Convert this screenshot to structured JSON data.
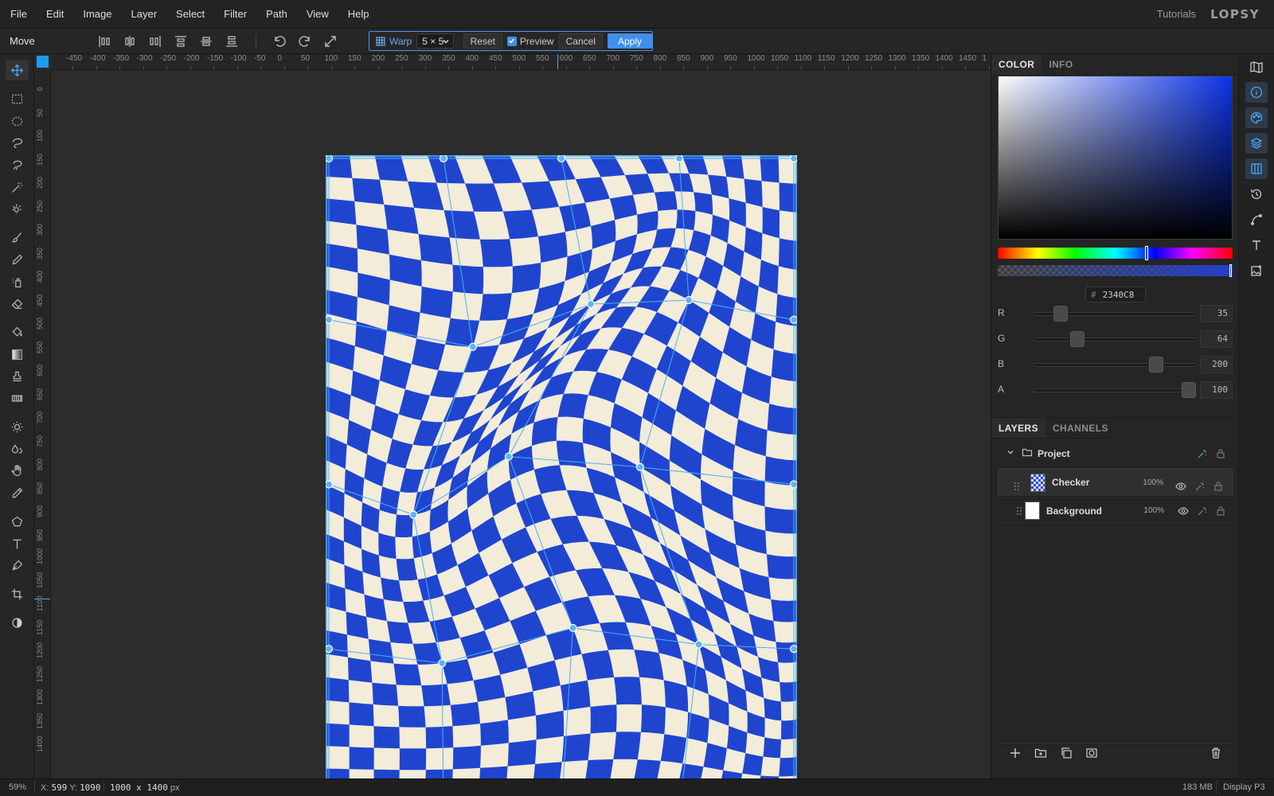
{
  "menu": [
    "File",
    "Edit",
    "Image",
    "Layer",
    "Select",
    "Filter",
    "Path",
    "View",
    "Help"
  ],
  "menu_right": {
    "tutorials": "Tutorials",
    "logo": "LOPSY"
  },
  "options": {
    "tool_name": "Move",
    "warp_label": "Warp",
    "grid_value": "5 × 5",
    "reset": "Reset",
    "preview": "Preview",
    "cancel": "Cancel",
    "apply": "Apply"
  },
  "ruler_h": [
    "-450",
    "-400",
    "-350",
    "-300",
    "-250",
    "-200",
    "-150",
    "-100",
    "-50",
    "0",
    "50",
    "100",
    "150",
    "200",
    "250",
    "300",
    "350",
    "400",
    "450",
    "500",
    "550",
    "600",
    "650",
    "700",
    "750",
    "800",
    "850",
    "900",
    "950",
    "1000",
    "1050",
    "1100",
    "1150",
    "1200",
    "1250",
    "1300",
    "1350",
    "1400",
    "1450",
    "1"
  ],
  "ruler_v": [
    "0",
    "50",
    "100",
    "150",
    "200",
    "250",
    "300",
    "350",
    "400",
    "450",
    "500",
    "550",
    "600",
    "650",
    "700",
    "750",
    "800",
    "850",
    "900",
    "950",
    "1000",
    "1050",
    "1100",
    "1150",
    "1200",
    "1250",
    "1300",
    "1350",
    "1400"
  ],
  "color_tabs": [
    "COLOR",
    "INFO"
  ],
  "hex_value": "2340C8",
  "channels": [
    {
      "name": "R",
      "value": "35",
      "pos": 0.14
    },
    {
      "name": "G",
      "value": "64",
      "pos": 0.25
    },
    {
      "name": "B",
      "value": "200",
      "pos": 0.78
    },
    {
      "name": "A",
      "value": "100",
      "pos": 1.0
    }
  ],
  "layer_tabs": [
    "LAYERS",
    "CHANNELS"
  ],
  "layers": {
    "group": "Project",
    "items": [
      {
        "name": "Checker",
        "opacity": "100%"
      },
      {
        "name": "Background",
        "opacity": "100%"
      }
    ]
  },
  "status": {
    "zoom": "59%",
    "x_label": "X:",
    "x": "599",
    "y_label": "Y:",
    "y": "1090",
    "size": "1000 x 1400",
    "unit": "px",
    "memory": "183 MB",
    "profile": "Display P3"
  },
  "colors": {
    "accent": "#3f8ff0",
    "checker_blue": "#1f45cf",
    "checker_cream": "#f2ecd8",
    "warp_line": "#4ab0f5"
  }
}
